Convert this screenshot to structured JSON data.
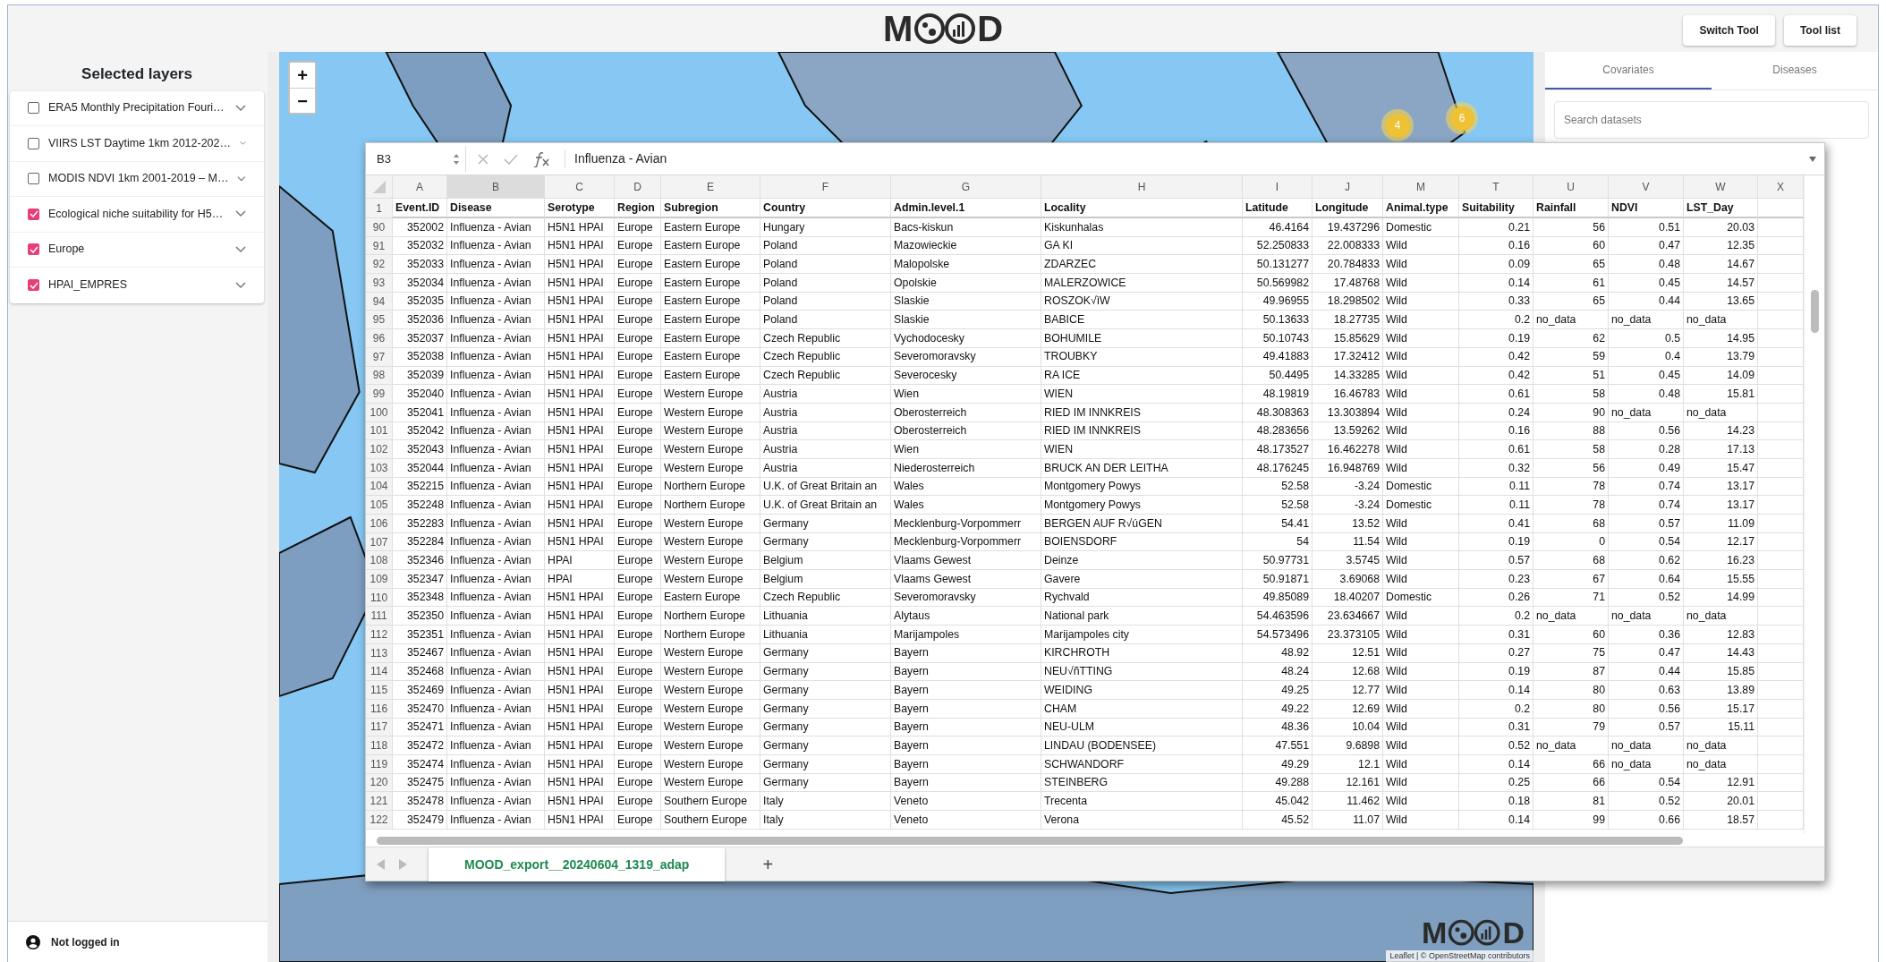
{
  "header": {
    "logo": {
      "left": "M",
      "right": "D"
    },
    "buttons": [
      "Switch Tool",
      "Tool list"
    ]
  },
  "sidebar": {
    "title": "Selected layers",
    "layers": [
      {
        "label": "ERA5 Monthly Precipitation Fouri…",
        "checked": false
      },
      {
        "label": "VIIRS LST Daytime 1km 2012-202…",
        "checked": false
      },
      {
        "label": "MODIS NDVI 1km 2001-2019 – M…",
        "checked": false
      },
      {
        "label": "Ecological niche suitability for H5…",
        "checked": true
      },
      {
        "label": "Europe",
        "checked": true
      },
      {
        "label": "HPAI_EMPRES",
        "checked": true
      }
    ],
    "user": "Not logged in"
  },
  "map": {
    "zoom_controls": [
      "+",
      "−"
    ],
    "clusters": [
      "4",
      "6"
    ],
    "logo": {
      "left": "M",
      "right": "D"
    },
    "attribution": "Leaflet | © OpenStreetMap contributors"
  },
  "right_panel": {
    "tabs": [
      {
        "label": "Covariates",
        "selected": true
      },
      {
        "label": "Diseases",
        "selected": false
      }
    ],
    "search": {
      "placeholder": "Search datasets"
    }
  },
  "spreadsheet": {
    "name_box": "B3",
    "formula": "Influenza - Avian",
    "columns": [
      {
        "letter": "A",
        "heading": "Event.ID",
        "selected": false
      },
      {
        "letter": "B",
        "heading": "Disease",
        "selected": true
      },
      {
        "letter": "C",
        "heading": "Serotype",
        "selected": false
      },
      {
        "letter": "D",
        "heading": "Region",
        "selected": false
      },
      {
        "letter": "E",
        "heading": "Subregion",
        "selected": false
      },
      {
        "letter": "F",
        "heading": "Country",
        "selected": false
      },
      {
        "letter": "G",
        "heading": "Admin.level.1",
        "selected": false
      },
      {
        "letter": "H",
        "heading": "Locality",
        "selected": false
      },
      {
        "letter": "I",
        "heading": "Latitude",
        "selected": false
      },
      {
        "letter": "J",
        "heading": "Longitude",
        "selected": false
      },
      {
        "letter": "M",
        "heading": "Animal.type",
        "selected": false
      },
      {
        "letter": "T",
        "heading": "Suitability",
        "selected": false
      },
      {
        "letter": "U",
        "heading": "Rainfall",
        "selected": false
      },
      {
        "letter": "V",
        "heading": "NDVI",
        "selected": false
      },
      {
        "letter": "W",
        "heading": "LST_Day",
        "selected": false
      },
      {
        "letter": "X",
        "selected": false
      }
    ],
    "header_row": "1",
    "rows": [
      {
        "number": "90",
        "cells": [
          "352002",
          "Influenza - Avian",
          "H5N1 HPAI",
          "Europe",
          "Eastern Europe",
          "Hungary",
          "Bacs-kiskun",
          "Kiskunhalas",
          "46.4164",
          "19.437296",
          "Domestic",
          "0.21",
          "56",
          "0.51",
          "20.03"
        ]
      },
      {
        "number": "91",
        "cells": [
          "352032",
          "Influenza - Avian",
          "H5N1 HPAI",
          "Europe",
          "Eastern Europe",
          "Poland",
          "Mazowieckie",
          "GA KI",
          "52.250833",
          "22.008333",
          "Wild",
          "0.16",
          "60",
          "0.47",
          "12.35"
        ]
      },
      {
        "number": "92",
        "cells": [
          "352033",
          "Influenza - Avian",
          "H5N1 HPAI",
          "Europe",
          "Eastern Europe",
          "Poland",
          "Malopolske",
          "ZDARZEC",
          "50.131277",
          "20.784833",
          "Wild",
          "0.09",
          "65",
          "0.48",
          "14.67"
        ]
      },
      {
        "number": "93",
        "cells": [
          "352034",
          "Influenza - Avian",
          "H5N1 HPAI",
          "Europe",
          "Eastern Europe",
          "Poland",
          "Opolskie",
          "MALERZOWICE",
          "50.569982",
          "17.48768",
          "Wild",
          "0.14",
          "61",
          "0.45",
          "14.57"
        ]
      },
      {
        "number": "94",
        "cells": [
          "352035",
          "Influenza - Avian",
          "H5N1 HPAI",
          "Europe",
          "Eastern Europe",
          "Poland",
          "Slaskie",
          "ROSZOK√ìW",
          "49.96955",
          "18.298502",
          "Wild",
          "0.33",
          "65",
          "0.44",
          "13.65"
        ]
      },
      {
        "number": "95",
        "cells": [
          "352036",
          "Influenza - Avian",
          "H5N1 HPAI",
          "Europe",
          "Eastern Europe",
          "Poland",
          "Slaskie",
          "BABICE",
          "50.13633",
          "18.27735",
          "Wild",
          "0.2",
          "no_data",
          "no_data",
          "no_data"
        ]
      },
      {
        "number": "96",
        "cells": [
          "352037",
          "Influenza - Avian",
          "H5N1 HPAI",
          "Europe",
          "Eastern Europe",
          "Czech Republic",
          "Vychodocesky",
          "BOHUMILE",
          "50.10743",
          "15.85629",
          "Wild",
          "0.19",
          "62",
          "0.5",
          "14.95"
        ]
      },
      {
        "number": "97",
        "cells": [
          "352038",
          "Influenza - Avian",
          "H5N1 HPAI",
          "Europe",
          "Eastern Europe",
          "Czech Republic",
          "Severomoravsky",
          "TROUBKY",
          "49.41883",
          "17.32412",
          "Wild",
          "0.42",
          "59",
          "0.4",
          "13.79"
        ]
      },
      {
        "number": "98",
        "cells": [
          "352039",
          "Influenza - Avian",
          "H5N1 HPAI",
          "Europe",
          "Eastern Europe",
          "Czech Republic",
          "Severocesky",
          "RA ICE",
          "50.4495",
          "14.33285",
          "Wild",
          "0.42",
          "51",
          "0.45",
          "14.09"
        ]
      },
      {
        "number": "99",
        "cells": [
          "352040",
          "Influenza - Avian",
          "H5N1 HPAI",
          "Europe",
          "Western Europe",
          "Austria",
          "Wien",
          "WIEN",
          "48.19819",
          "16.46783",
          "Wild",
          "0.61",
          "58",
          "0.48",
          "15.81"
        ]
      },
      {
        "number": "100",
        "cells": [
          "352041",
          "Influenza - Avian",
          "H5N1 HPAI",
          "Europe",
          "Western Europe",
          "Austria",
          "Oberosterreich",
          "RIED IM INNKREIS",
          "48.308363",
          "13.303894",
          "Wild",
          "0.24",
          "90",
          "no_data",
          "no_data"
        ]
      },
      {
        "number": "101",
        "cells": [
          "352042",
          "Influenza - Avian",
          "H5N1 HPAI",
          "Europe",
          "Western Europe",
          "Austria",
          "Oberosterreich",
          "RIED IM INNKREIS",
          "48.283656",
          "13.59262",
          "Wild",
          "0.16",
          "88",
          "0.56",
          "14.23"
        ]
      },
      {
        "number": "102",
        "cells": [
          "352043",
          "Influenza - Avian",
          "H5N1 HPAI",
          "Europe",
          "Western Europe",
          "Austria",
          "Wien",
          "WIEN",
          "48.173527",
          "16.462278",
          "Wild",
          "0.61",
          "58",
          "0.28",
          "17.13"
        ]
      },
      {
        "number": "103",
        "cells": [
          "352044",
          "Influenza - Avian",
          "H5N1 HPAI",
          "Europe",
          "Western Europe",
          "Austria",
          "Niederosterreich",
          "BRUCK AN DER LEITHA",
          "48.176245",
          "16.948769",
          "Wild",
          "0.32",
          "56",
          "0.49",
          "15.47"
        ]
      },
      {
        "number": "104",
        "cells": [
          "352215",
          "Influenza - Avian",
          "H5N1 HPAI",
          "Europe",
          "Northern Europe",
          "U.K. of Great Britain an",
          "Wales",
          "Montgomery  Powys",
          "52.58",
          "-3.24",
          "Domestic",
          "0.11",
          "78",
          "0.74",
          "13.17"
        ]
      },
      {
        "number": "105",
        "cells": [
          "352248",
          "Influenza - Avian",
          "H5N1 HPAI",
          "Europe",
          "Northern Europe",
          "U.K. of Great Britain an",
          "Wales",
          "Montgomery  Powys",
          "52.58",
          "-3.24",
          "Domestic",
          "0.11",
          "78",
          "0.74",
          "13.17"
        ]
      },
      {
        "number": "106",
        "cells": [
          "352283",
          "Influenza - Avian",
          "H5N1 HPAI",
          "Europe",
          "Western Europe",
          "Germany",
          "Mecklenburg-Vorpommerr",
          "BERGEN AUF R√úGEN",
          "54.41",
          "13.52",
          "Wild",
          "0.41",
          "68",
          "0.57",
          "11.09"
        ]
      },
      {
        "number": "107",
        "cells": [
          "352284",
          "Influenza - Avian",
          "H5N1 HPAI",
          "Europe",
          "Western Europe",
          "Germany",
          "Mecklenburg-Vorpommerr",
          "BOIENSDORF",
          "54",
          "11.54",
          "Wild",
          "0.19",
          "0",
          "0.54",
          "12.17"
        ]
      },
      {
        "number": "108",
        "cells": [
          "352346",
          "Influenza - Avian",
          "HPAI",
          "Europe",
          "Western Europe",
          "Belgium",
          "Vlaams Gewest",
          "Deinze",
          "50.97731",
          "3.5745",
          "Wild",
          "0.57",
          "68",
          "0.62",
          "16.23"
        ]
      },
      {
        "number": "109",
        "cells": [
          "352347",
          "Influenza - Avian",
          "HPAI",
          "Europe",
          "Western Europe",
          "Belgium",
          "Vlaams Gewest",
          "Gavere",
          "50.91871",
          "3.69068",
          "Wild",
          "0.23",
          "67",
          "0.64",
          "15.55"
        ]
      },
      {
        "number": "110",
        "cells": [
          "352348",
          "Influenza - Avian",
          "H5N1 HPAI",
          "Europe",
          "Eastern Europe",
          "Czech Republic",
          "Severomoravsky",
          "Rychvald",
          "49.85089",
          "18.40207",
          "Domestic",
          "0.26",
          "71",
          "0.52",
          "14.99"
        ]
      },
      {
        "number": "111",
        "cells": [
          "352350",
          "Influenza - Avian",
          "H5N1 HPAI",
          "Europe",
          "Northern Europe",
          "Lithuania",
          "Alytaus",
          "National park",
          "54.463596",
          "23.634667",
          "Wild",
          "0.2",
          "no_data",
          "no_data",
          "no_data"
        ]
      },
      {
        "number": "112",
        "cells": [
          "352351",
          "Influenza - Avian",
          "H5N1 HPAI",
          "Europe",
          "Northern Europe",
          "Lithuania",
          "Marijampoles",
          "Marijampoles city",
          "54.573496",
          "23.373105",
          "Wild",
          "0.31",
          "60",
          "0.36",
          "12.83"
        ]
      },
      {
        "number": "113",
        "cells": [
          "352467",
          "Influenza - Avian",
          "H5N1 HPAI",
          "Europe",
          "Western Europe",
          "Germany",
          "Bayern",
          "KIRCHROTH",
          "48.92",
          "12.51",
          "Wild",
          "0.27",
          "75",
          "0.47",
          "14.43"
        ]
      },
      {
        "number": "114",
        "cells": [
          "352468",
          "Influenza - Avian",
          "H5N1 HPAI",
          "Europe",
          "Western Europe",
          "Germany",
          "Bayern",
          "NEU√ñTTING",
          "48.24",
          "12.68",
          "Wild",
          "0.19",
          "87",
          "0.44",
          "15.85"
        ]
      },
      {
        "number": "115",
        "cells": [
          "352469",
          "Influenza - Avian",
          "H5N1 HPAI",
          "Europe",
          "Western Europe",
          "Germany",
          "Bayern",
          "WEIDING",
          "49.25",
          "12.77",
          "Wild",
          "0.14",
          "80",
          "0.63",
          "13.89"
        ]
      },
      {
        "number": "116",
        "cells": [
          "352470",
          "Influenza - Avian",
          "H5N1 HPAI",
          "Europe",
          "Western Europe",
          "Germany",
          "Bayern",
          "CHAM",
          "49.22",
          "12.69",
          "Wild",
          "0.2",
          "80",
          "0.56",
          "15.17"
        ]
      },
      {
        "number": "117",
        "cells": [
          "352471",
          "Influenza - Avian",
          "H5N1 HPAI",
          "Europe",
          "Western Europe",
          "Germany",
          "Bayern",
          "NEU-ULM",
          "48.36",
          "10.04",
          "Wild",
          "0.31",
          "79",
          "0.57",
          "15.11"
        ]
      },
      {
        "number": "118",
        "cells": [
          "352472",
          "Influenza - Avian",
          "H5N1 HPAI",
          "Europe",
          "Western Europe",
          "Germany",
          "Bayern",
          "LINDAU (BODENSEE)",
          "47.551",
          "9.6898",
          "Wild",
          "0.52",
          "no_data",
          "no_data",
          "no_data"
        ]
      },
      {
        "number": "119",
        "cells": [
          "352474",
          "Influenza - Avian",
          "H5N1 HPAI",
          "Europe",
          "Western Europe",
          "Germany",
          "Bayern",
          "SCHWANDORF",
          "49.29",
          "12.1",
          "Wild",
          "0.14",
          "66",
          "no_data",
          "no_data"
        ]
      },
      {
        "number": "120",
        "cells": [
          "352475",
          "Influenza - Avian",
          "H5N1 HPAI",
          "Europe",
          "Western Europe",
          "Germany",
          "Bayern",
          "STEINBERG",
          "49.288",
          "12.161",
          "Wild",
          "0.25",
          "66",
          "0.54",
          "12.91"
        ]
      },
      {
        "number": "121",
        "cells": [
          "352478",
          "Influenza - Avian",
          "H5N1 HPAI",
          "Europe",
          "Southern Europe",
          "Italy",
          "Veneto",
          "Trecenta",
          "45.042",
          "11.462",
          "Wild",
          "0.18",
          "81",
          "0.52",
          "20.01"
        ]
      },
      {
        "number": "122",
        "cells": [
          "352479",
          "Influenza - Avian",
          "H5N1 HPAI",
          "Europe",
          "Southern Europe",
          "Italy",
          "Veneto",
          "Verona",
          "45.52",
          "11.07",
          "Wild",
          "0.14",
          "99",
          "0.66",
          "18.57"
        ]
      }
    ],
    "sheet_tabs": [
      {
        "label": "MOOD_export__20240604_1319_adap",
        "selected": true
      }
    ],
    "add_sheet": "+"
  }
}
